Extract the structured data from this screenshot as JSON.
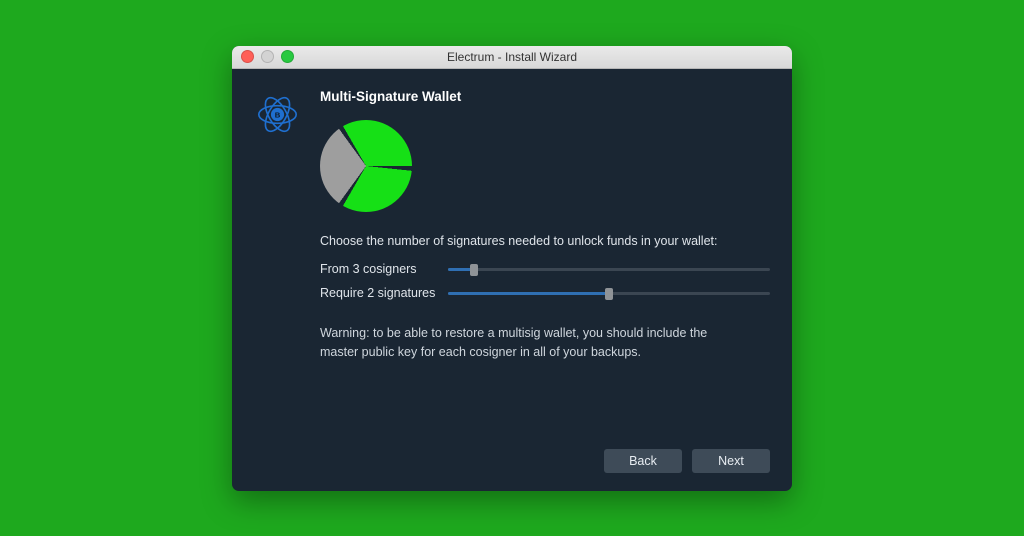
{
  "window": {
    "title": "Electrum  -  Install Wizard"
  },
  "heading": "Multi-Signature Wallet",
  "instruction": "Choose the number of signatures needed to unlock funds in your wallet:",
  "sliders": {
    "cosigners": {
      "label": "From 3 cosigners",
      "value": 3,
      "min": 2,
      "max": 15
    },
    "required": {
      "label": "Require 2 signatures",
      "value": 2,
      "min": 1,
      "max": 3
    }
  },
  "warning": "Warning: to be able to restore a multisig wallet, you should include the master public key for each cosigner in all of your backups.",
  "buttons": {
    "back": "Back",
    "next": "Next"
  },
  "chart_data": {
    "type": "pie",
    "title": "",
    "categories": [
      "required-signature",
      "required-signature",
      "remaining-cosigner"
    ],
    "values": [
      1,
      1,
      1
    ],
    "colors": [
      "#16e016",
      "#16e016",
      "#9e9e9e"
    ]
  },
  "colors": {
    "accent": "#2f6fb3",
    "panel": "#1a2633",
    "highlight": "#16e016"
  }
}
